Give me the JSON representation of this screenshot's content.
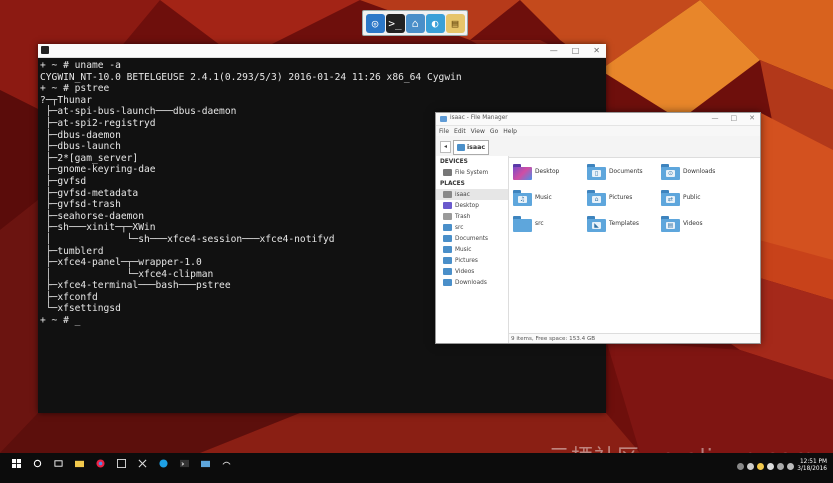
{
  "terminal": {
    "lines": [
      "+ ~ # uname -a",
      "CYGWIN_NT-10.0 BETELGEUSE 2.4.1(0.293/5/3) 2016-01-24 11:26 x86_64 Cygwin",
      "+ ~ # pstree",
      "?─┬Thunar",
      " ├─at-spi-bus-launch───dbus-daemon",
      " ├─at-spi2-registryd",
      " ├─dbus-daemon",
      " ├─dbus-launch",
      " ├─2*[gam_server]",
      " ├─gnome-keyring-dae",
      " ├─gvfsd",
      " ├─gvfsd-metadata",
      " ├─gvfsd-trash",
      " ├─seahorse-daemon",
      " ├─sh───xinit─┬─XWin",
      " │             └─sh───xfce4-session───xfce4-notifyd",
      " ├─tumblerd",
      " ├─xfce4-panel─┬─wrapper-1.0",
      " │             └─xfce4-clipman",
      " ├─xfce4-terminal───bash───pstree",
      " ├─xfconfd",
      " └─xfsettingsd",
      "+ ~ # _"
    ]
  },
  "file_manager": {
    "title": "isaac - File Manager",
    "menu": [
      "File",
      "Edit",
      "View",
      "Go",
      "Help"
    ],
    "breadcrumb": "isaac",
    "devices_heading": "DEVICES",
    "devices": [
      {
        "label": "File System",
        "icon": "drive-icon"
      }
    ],
    "places_heading": "PLACES",
    "places": [
      {
        "label": "isaac",
        "icon": "home-icon",
        "selected": true
      },
      {
        "label": "Desktop",
        "icon": "desktop-icon"
      },
      {
        "label": "Trash",
        "icon": "trash-icon"
      },
      {
        "label": "src",
        "icon": "folder-icon"
      },
      {
        "label": "Documents",
        "icon": "folder-icon"
      },
      {
        "label": "Music",
        "icon": "folder-icon"
      },
      {
        "label": "Pictures",
        "icon": "folder-icon"
      },
      {
        "label": "Videos",
        "icon": "folder-icon"
      },
      {
        "label": "Downloads",
        "icon": "folder-icon"
      }
    ],
    "items": [
      {
        "label": "Desktop",
        "emblem": ""
      },
      {
        "label": "Documents",
        "emblem": "▯"
      },
      {
        "label": "Downloads",
        "emblem": "⊙"
      },
      {
        "label": "Music",
        "emblem": "♫"
      },
      {
        "label": "Pictures",
        "emblem": "⌂"
      },
      {
        "label": "Public",
        "emblem": "⇄"
      },
      {
        "label": "src",
        "emblem": ""
      },
      {
        "label": "Templates",
        "emblem": "◣"
      },
      {
        "label": "Videos",
        "emblem": "▤"
      }
    ],
    "status": "9 items, Free space: 153.4 GB"
  },
  "watermark": "云栖社区 yq.aliyun.com",
  "clock": {
    "time": "12:51 PM",
    "date": "3/18/2016"
  },
  "colors": {
    "folder": "#5ea6dc",
    "terminal_bg": "#111111",
    "taskbar": "#0c0c0c"
  }
}
